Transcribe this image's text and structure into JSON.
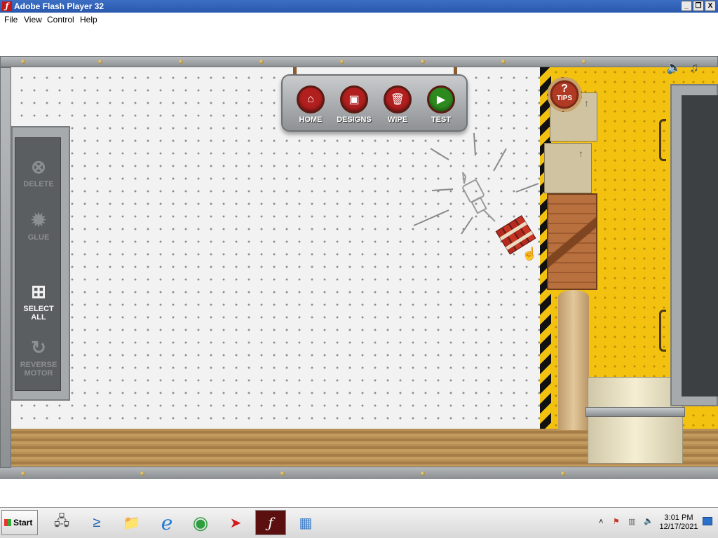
{
  "window": {
    "title": "Adobe Flash Player 32",
    "minimize": "_",
    "maximize": "❐",
    "close": "X"
  },
  "menu": [
    "File",
    "View",
    "Control",
    "Help"
  ],
  "game": {
    "tools": [
      {
        "label": "DELETE",
        "icon": "delete-icon",
        "glyph": "⊗"
      },
      {
        "label": "GLUE",
        "icon": "glue-icon",
        "glyph": "✹"
      },
      {
        "label": "SELECT ALL",
        "icon": "select-all-icon",
        "glyph": "⊞"
      },
      {
        "label": "REVERSE MOTOR",
        "icon": "reverse-motor-icon",
        "glyph": "↻"
      }
    ],
    "nav": [
      {
        "label": "HOME",
        "icon": "home-icon",
        "glyph": "⌂",
        "color": "#b21f1f"
      },
      {
        "label": "DESIGNS",
        "icon": "save-icon",
        "glyph": "▣",
        "color": "#b21f1f"
      },
      {
        "label": "WIPE",
        "icon": "trash-icon",
        "glyph": "🗑",
        "color": "#b21f1f"
      },
      {
        "label": "TEST",
        "icon": "play-icon",
        "glyph": "▶",
        "color": "#2d8a1e"
      }
    ],
    "tips": {
      "q": "?",
      "label": "TIPS"
    },
    "sound_icon": "🔈",
    "music_icon": "♫"
  },
  "taskbar": {
    "start": "Start",
    "icons": [
      {
        "name": "server-manager-icon",
        "glyph": "🖧"
      },
      {
        "name": "powershell-icon",
        "glyph": "≥"
      },
      {
        "name": "file-explorer-icon",
        "glyph": "📁"
      },
      {
        "name": "internet-explorer-icon",
        "glyph": "ℯ"
      },
      {
        "name": "chrome-icon",
        "glyph": "◉"
      },
      {
        "name": "acrobat-icon",
        "glyph": "➤"
      },
      {
        "name": "flash-player-icon",
        "glyph": "ƒ"
      },
      {
        "name": "control-panel-icon",
        "glyph": "▦"
      }
    ],
    "tray_chevron": "˄",
    "time": "3:01 PM",
    "date": "12/17/2021"
  }
}
